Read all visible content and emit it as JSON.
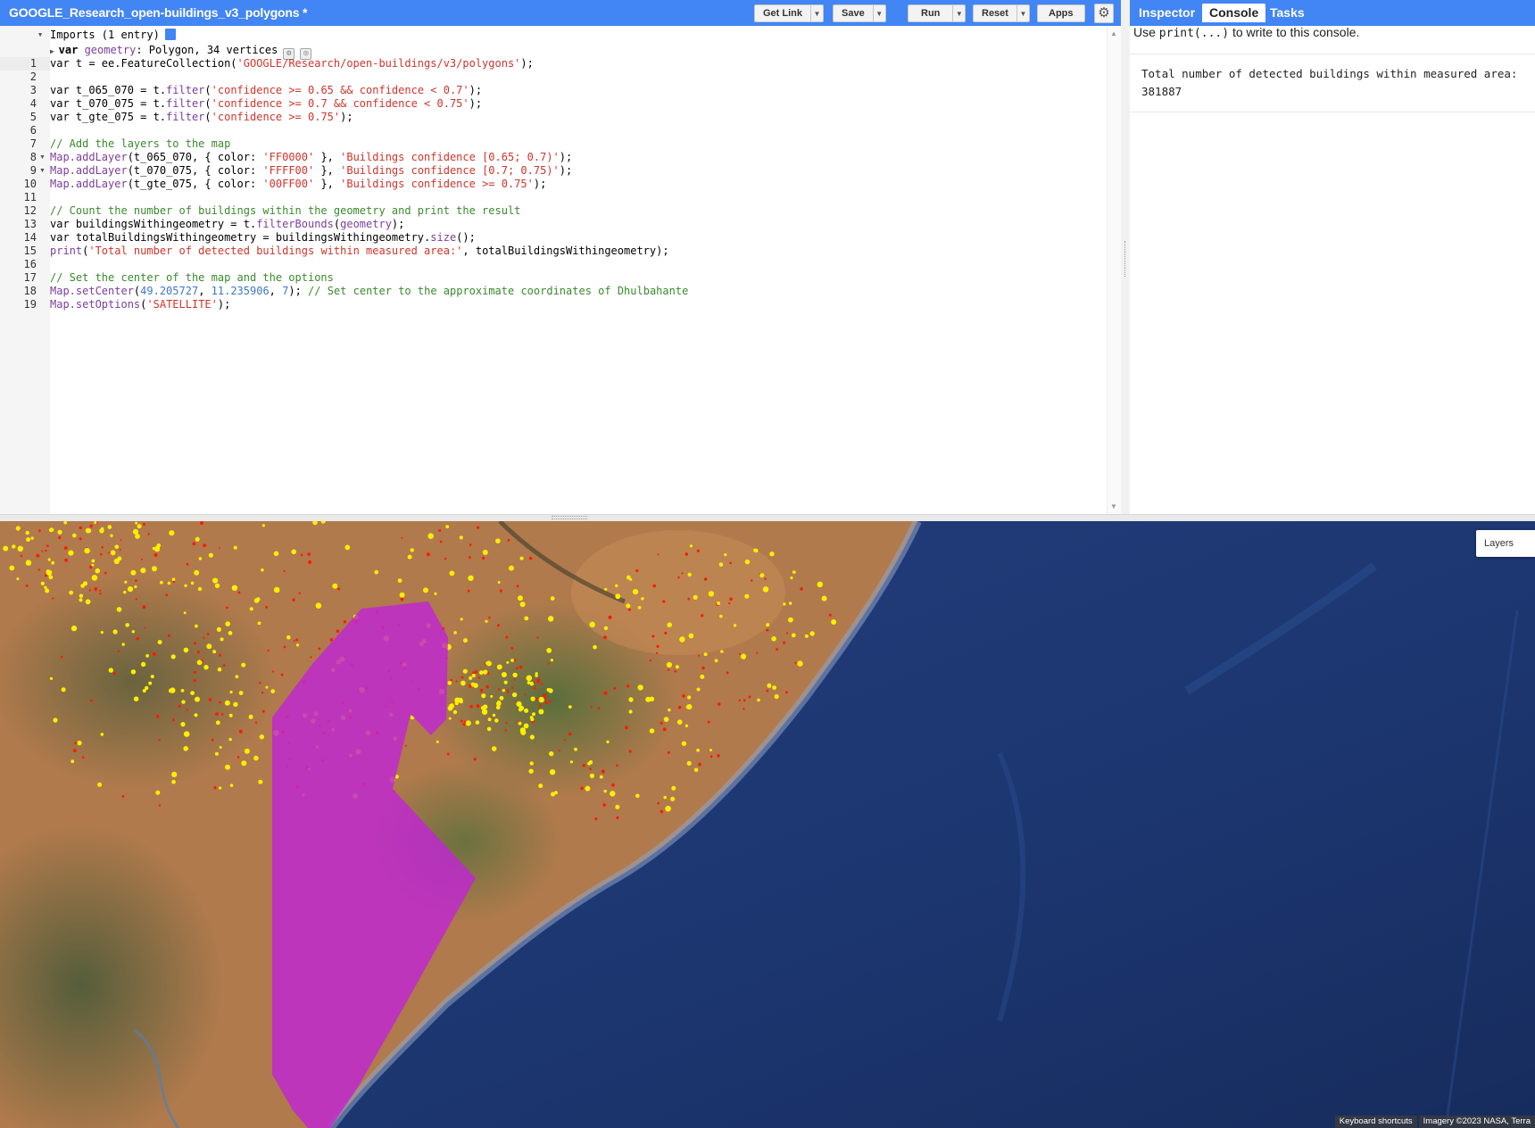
{
  "editor": {
    "title": "GOOGLE_Research_open-buildings_v3_polygons *",
    "buttons": {
      "get_link": "Get Link",
      "save": "Save",
      "run": "Run",
      "reset": "Reset",
      "apps": "Apps"
    },
    "imports": {
      "header": "Imports (1 entry)",
      "var_kw": "var",
      "var_name": "geometry",
      "var_desc": ": Polygon, 34 vertices"
    },
    "line_numbers": [
      "1",
      "2",
      "3",
      "4",
      "5",
      "6",
      "7",
      "8",
      "9",
      "10",
      "11",
      "12",
      "13",
      "14",
      "15",
      "16",
      "17",
      "18",
      "19"
    ],
    "code": {
      "l1a": "var t = ee.FeatureCollection(",
      "l1b": "'GOOGLE/Research/open-buildings/v3/polygons'",
      "l1c": ");",
      "l3a": "var t_065_070 = t.",
      "l3b": "filter",
      "l3c": "(",
      "l3d": "'confidence >= 0.65 && confidence < 0.7'",
      "l3e": ");",
      "l4a": "var t_070_075 = t.",
      "l4b": "filter",
      "l4c": "(",
      "l4d": "'confidence >= 0.7 && confidence < 0.75'",
      "l4e": ");",
      "l5a": "var t_gte_075 = t.",
      "l5b": "filter",
      "l5c": "(",
      "l5d": "'confidence >= 0.75'",
      "l5e": ");",
      "l7": "// Add the layers to the map",
      "l8a": "Map.addLayer",
      "l8b": "(t_065_070, { color: ",
      "l8c": "'FF0000'",
      "l8d": " }, ",
      "l8e": "'Buildings confidence [0.65; 0.7)'",
      "l8f": ");",
      "l9a": "Map.addLayer",
      "l9b": "(t_070_075, { color: ",
      "l9c": "'FFFF00'",
      "l9d": " }, ",
      "l9e": "'Buildings confidence [0.7; 0.75)'",
      "l9f": ");",
      "l10a": "Map.addLayer",
      "l10b": "(t_gte_075, { color: ",
      "l10c": "'00FF00'",
      "l10d": " }, ",
      "l10e": "'Buildings confidence >= 0.75'",
      "l10f": ");",
      "l12": "// Count the number of buildings within the geometry and print the result",
      "l13a": "var buildingsWithingeometry = t.",
      "l13b": "filterBounds",
      "l13c": "(",
      "l13d": "geometry",
      "l13e": ");",
      "l14a": "var totalBuildingsWithingeometry = buildingsWithingeometry.",
      "l14b": "size",
      "l14c": "();",
      "l15a": "print",
      "l15b": "(",
      "l15c": "'Total number of detected buildings within measured area:'",
      "l15d": ", totalBuildingsWithingeometry);",
      "l17": "// Set the center of the map and the options",
      "l18a": "Map.setCenter",
      "l18b": "(",
      "l18c": "49.205727",
      "l18d": ", ",
      "l18e": "11.235906",
      "l18f": ", ",
      "l18g": "7",
      "l18h": "); ",
      "l18i": "// Set center to the approximate coordinates of Dhulbahante",
      "l19a": "Map.setOptions",
      "l19b": "(",
      "l19c": "'SATELLITE'",
      "l19d": ");"
    }
  },
  "panel": {
    "tabs": [
      "Inspector",
      "Console",
      "Tasks"
    ],
    "active_tab": "Console",
    "hint_pre": "Use ",
    "hint_code": "print(...)",
    "hint_post": " to write to this console.",
    "output_label": "Total number of detected buildings within measured area:",
    "output_value": "381887"
  },
  "map": {
    "layers_label": "Layers",
    "keyboard_shortcuts": "Keyboard shortcuts",
    "attribution": "Imagery ©2023 NASA, Terra",
    "colors": {
      "land": "#b07a4c",
      "ocean": "#1c3670",
      "geometry": "#c026d3",
      "building_low": "#ff1a00",
      "building_mid": "#ffee00"
    }
  },
  "icons": [
    "settings-icon",
    "script-doc-icon",
    "import-edit-icon",
    "import-delete-icon",
    "dropdown-arrow-icon"
  ]
}
